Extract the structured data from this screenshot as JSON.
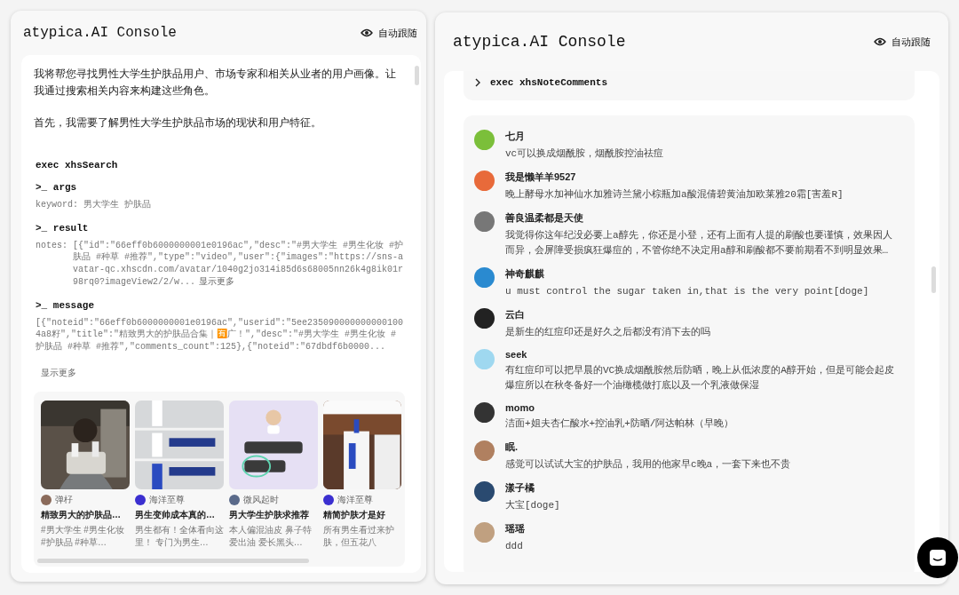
{
  "left_panel": {
    "title": "atypica.AI Console",
    "follow_label": "自动跟随",
    "paragraphs": [
      "我将帮您寻找男性大学生护肤品用户、市场专家和相关从业者的用户画像。让我通过搜索相关内容来构建这些角色。",
      "首先，我需要了解男性大学生护肤品市场的现状和用户特征。"
    ],
    "tool": {
      "name": "exec xhsSearch",
      "sections": [
        {
          "label": ">_ args",
          "key": "keyword:",
          "value": "男大学生 护肤品"
        },
        {
          "label": ">_ result",
          "key": "notes:",
          "value": "[{\"id\":\"66eff0b6000000001e0196ac\",\"desc\":\"#男大学生  #男生化妆 #护肤品  #种草  #推荐\",\"type\":\"video\",\"user\":{\"images\":\"https://sns-avatar-qc.xhscdn.com/avatar/1040g2jo314i85d6s68005nn26k4g8ik01r98rq0?imageView2/2/w...",
          "more": "显示更多"
        },
        {
          "label": ">_ message",
          "value": "[{\"noteid\":\"66eff0b6000000001e0196ac\",\"userid\":\"5ee2350900000000001004a8籽\",\"title\":\"精致男大的护肤品合集｜🈶广！\",\"desc\":\"#男大学生  #男生化妆  #护肤品  #种草  #推荐\",\"comments_count\":125},{\"noteid\":\"67dbdf6b0000...",
          "more": "显示更多"
        }
      ]
    },
    "notes": [
      {
        "author": "弹杍",
        "title": "精致男大的护肤品…",
        "desc": "#男大学生 #男生化妆 #护肤品 #种草…"
      },
      {
        "author": "海洋至尊",
        "title": "男生变帅成本真的…",
        "desc": "男生都有！全体看向这里！ 专门为男生…"
      },
      {
        "author": "微风起时",
        "title": "男大学生护肤求推荐",
        "desc": "本人偏混油皮 鼻子特爱出油 爱长黑头…"
      },
      {
        "author": "海洋至尊",
        "title": "精简护肤才是好",
        "desc": "所有男生看过来护肤，但五花八"
      }
    ]
  },
  "right_panel": {
    "title": "atypica.AI Console",
    "follow_label": "自动跟随",
    "tool": {
      "name": "exec xhsNoteComments"
    },
    "comments": [
      {
        "name": "七月",
        "text": "vc可以换成烟酰胺，烟酰胺控油祛痘"
      },
      {
        "name": "我是懒羊羊9527",
        "text": "晚上酵母水加神仙水加雅诗兰黛小棕瓶加a酸混倩碧黄油加欧莱雅20霜[害羞R]"
      },
      {
        "name": "善良温柔都是天使",
        "text": "我觉得你这年纪没必要上a醇先，你还是小登，还有上面有人提的刷酸也要谨慎，效果因人而异，会屏障受损疯狂爆痘的，不管你绝不决定用a醇和刷酸都不要前期看不到明显效果…"
      },
      {
        "name": "神奇麒麒",
        "text": "u must control the sugar taken in,that is the very point[doge]"
      },
      {
        "name": "云白",
        "text": "是新生的红痘印还是好久之后都没有消下去的吗"
      },
      {
        "name": "seek",
        "text": "有红痘印可以把早晨的VC换成烟酰胺然后防晒，晚上从低浓度的A醇开始，但是可能会起皮爆痘所以在秋冬备好一个油橄榄做打底以及一个乳液做保湿"
      },
      {
        "name": "momo",
        "text": "洁面+姐夫杏仁酸水+控油乳+防晒/阿达帕林（早晚）"
      },
      {
        "name": "眠.",
        "text": "感觉可以试试大宝的护肤品，我用的他家早c晚a，一套下来也不贵"
      },
      {
        "name": "漾子橘",
        "text": "大宝[doge]"
      },
      {
        "name": "瑶瑶",
        "text": "ddd"
      }
    ]
  }
}
